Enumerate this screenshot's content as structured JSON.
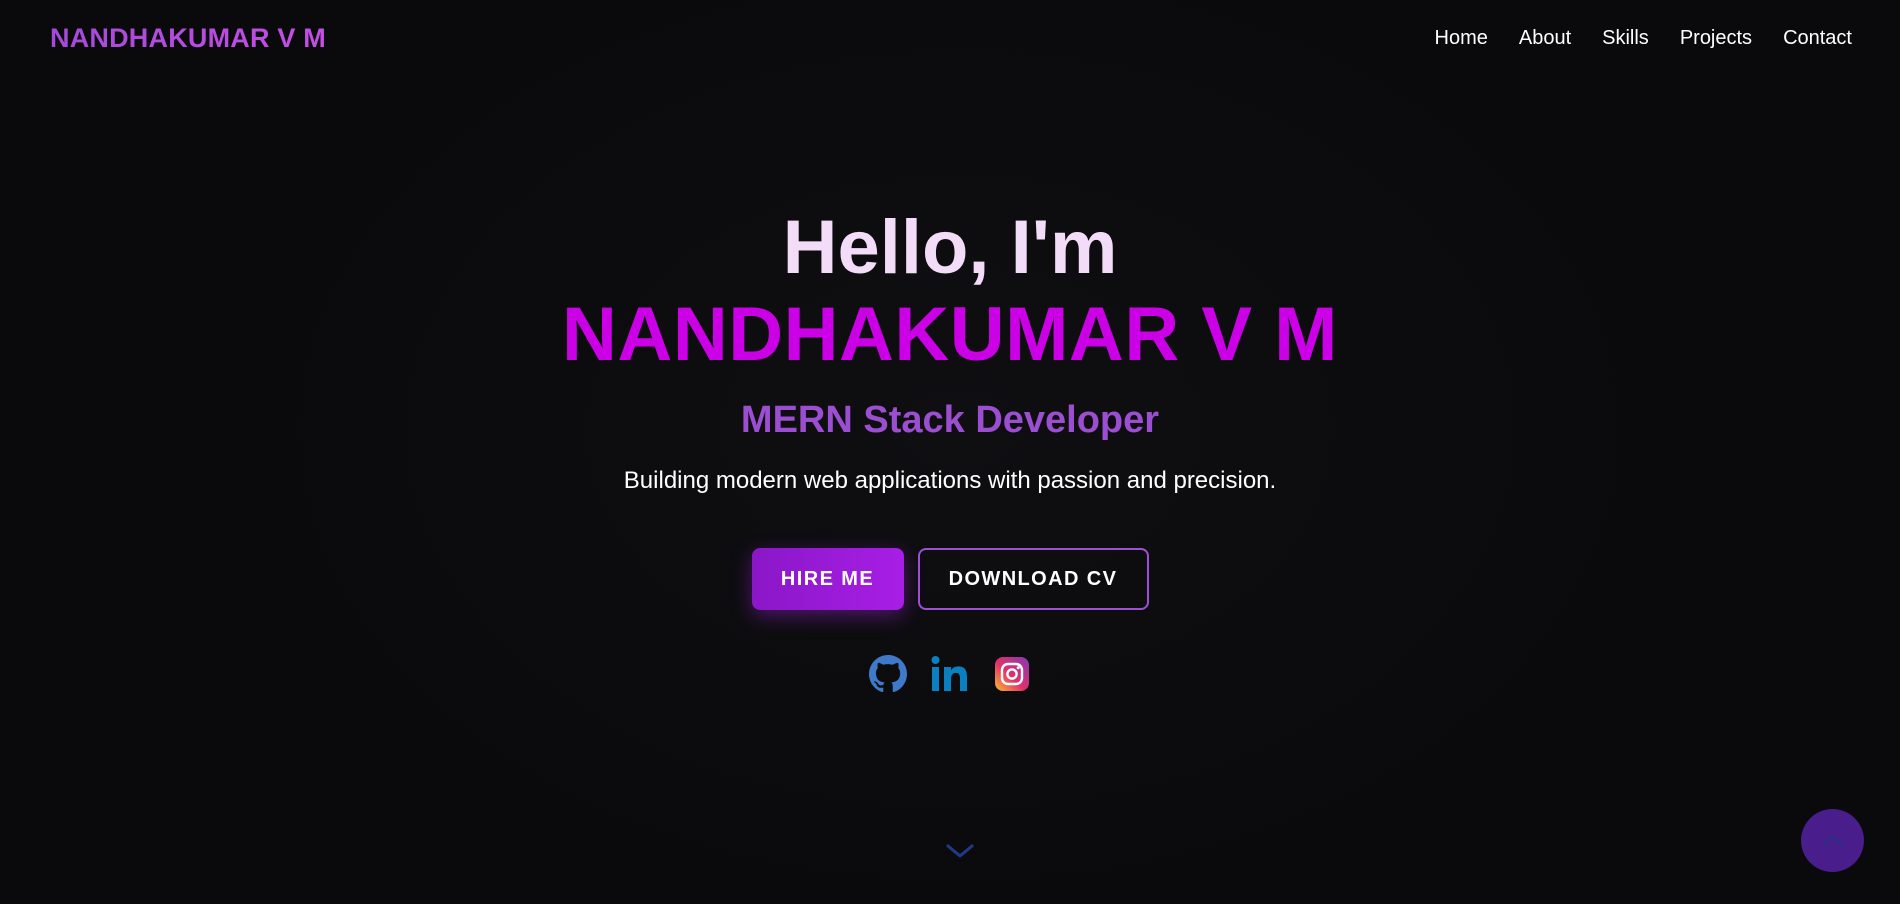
{
  "navbar": {
    "brand": "NANDHAKUMAR V M",
    "links": [
      {
        "label": "Home"
      },
      {
        "label": "About"
      },
      {
        "label": "Skills"
      },
      {
        "label": "Projects"
      },
      {
        "label": "Contact"
      }
    ]
  },
  "hero": {
    "greeting": "Hello, I'm",
    "name": "NANDHAKUMAR V M",
    "role": "MERN Stack Developer",
    "tagline": "Building modern web applications with passion and precision.",
    "primary_button": "HIRE ME",
    "secondary_button": "DOWNLOAD CV",
    "socials": [
      {
        "icon": "github-icon"
      },
      {
        "icon": "linkedin-icon"
      },
      {
        "icon": "instagram-icon"
      }
    ]
  },
  "scroll_cue": {
    "icon": "chevron-down-icon"
  },
  "back_to_top": {
    "icon": "chevron-up-icon"
  },
  "colors": {
    "background": "#0b0b0d",
    "accent": "#cc00e6",
    "role_text": "#9b4fd0",
    "button_primary": "#9a1bd9",
    "back_to_top": "#4a1d8c"
  }
}
